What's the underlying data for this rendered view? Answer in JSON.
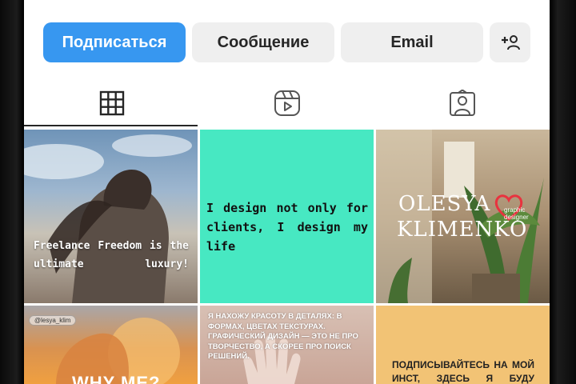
{
  "actions": {
    "follow_label": "Подписаться",
    "message_label": "Сообщение",
    "email_label": "Email",
    "add_user_icon": "person-plus-icon"
  },
  "tabs": [
    {
      "icon": "grid-icon",
      "selected": true
    },
    {
      "icon": "reels-icon",
      "selected": false
    },
    {
      "icon": "tagged-icon",
      "selected": false
    }
  ],
  "posts": [
    {
      "text": "Freelance Freedom is the ultimate luxury!"
    },
    {
      "text": "I design not only for clients, I design my life"
    },
    {
      "brand_line1": "OLESYA",
      "brand_line2": "KLIMENKO",
      "brand_sub": "graphic designer"
    },
    {
      "handle": "@lesya_klim",
      "text": "WHY ME?"
    },
    {
      "text": "Я НАХОЖУ КРАСОТУ В ДЕТАЛЯХ: В ФОРМАХ, ЦВЕТАХ ТЕКСТУРАХ. ГРАФИЧЕСКИЙ ДИЗАЙН — ЭТО НЕ ПРО ТВОРЧЕСТВО, А СКОРЕЕ ПРО ПОИСК РЕШЕНИЙ."
    },
    {
      "text": "ПОДПИСЫВАЙТЕСЬ НА МОЙ ИНСТ, ЗДЕСЬ Я БУДУ"
    }
  ],
  "colors": {
    "follow_blue": "#3797f0",
    "button_gray": "#efefef",
    "teal_post": "#47e8c2",
    "yellow_post": "#f2c375"
  }
}
